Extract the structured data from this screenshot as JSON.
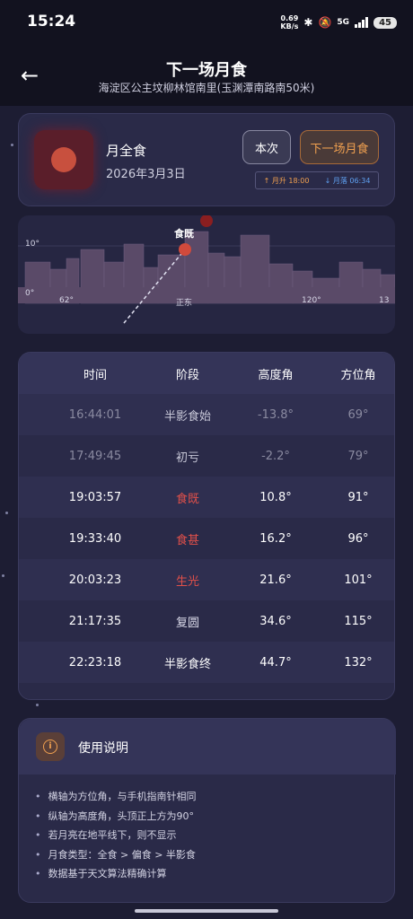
{
  "status_bar": {
    "time": "15:24",
    "net_speed": "0.69",
    "net_unit": "KB/s",
    "bt_icon": "bluetooth-icon",
    "mute_icon": "mute-icon",
    "network": "5G",
    "battery": "45"
  },
  "header": {
    "title": "下一场月食",
    "location": "海淀区公主坟柳林馆南里(玉渊潭南路南50米)"
  },
  "eclipse": {
    "type": "月全食",
    "date": "2026年3月3日",
    "btn_current": "本次",
    "btn_next": "下一场月食",
    "moonrise": "↑ 月升 18:00",
    "moonset": "↓ 月落 06:34"
  },
  "sky_chart": {
    "eclipse_label": "食既",
    "alt_label": "10°",
    "zero_label": "0°",
    "az_62": "62°",
    "az_east": "正东",
    "az_120": "120°",
    "az_end": "13"
  },
  "table": {
    "headers": [
      "时间",
      "阶段",
      "高度角",
      "方位角"
    ],
    "rows": [
      {
        "time": "16:44:01",
        "phase": "半影食始",
        "alt": "-13.8°",
        "az": "69°"
      },
      {
        "time": "17:49:45",
        "phase": "初亏",
        "alt": "-2.2°",
        "az": "79°"
      },
      {
        "time": "19:03:57",
        "phase": "食既",
        "alt": "10.8°",
        "az": "91°"
      },
      {
        "time": "19:33:40",
        "phase": "食甚",
        "alt": "16.2°",
        "az": "96°"
      },
      {
        "time": "20:03:23",
        "phase": "生光",
        "alt": "21.6°",
        "az": "101°"
      },
      {
        "time": "21:17:35",
        "phase": "复圆",
        "alt": "34.6°",
        "az": "115°"
      },
      {
        "time": "22:23:18",
        "phase": "半影食终",
        "alt": "44.7°",
        "az": "132°"
      }
    ]
  },
  "help": {
    "title": "使用说明",
    "items": [
      "横轴为方位角，与手机指南针相同",
      "纵轴为高度角，头顶正上方为90°",
      "若月亮在地平线下，则不显示",
      "月食类型：全食 > 偏食 > 半影食",
      "数据基于天文算法精确计算"
    ]
  },
  "colors": {
    "background": "#1d1d33",
    "card": "#2a2a48",
    "accent_orange": "#f0a050",
    "accent_red": "#e0504a",
    "accent_blue": "#5fa0f0",
    "dim_text": "#8a8aa0"
  }
}
